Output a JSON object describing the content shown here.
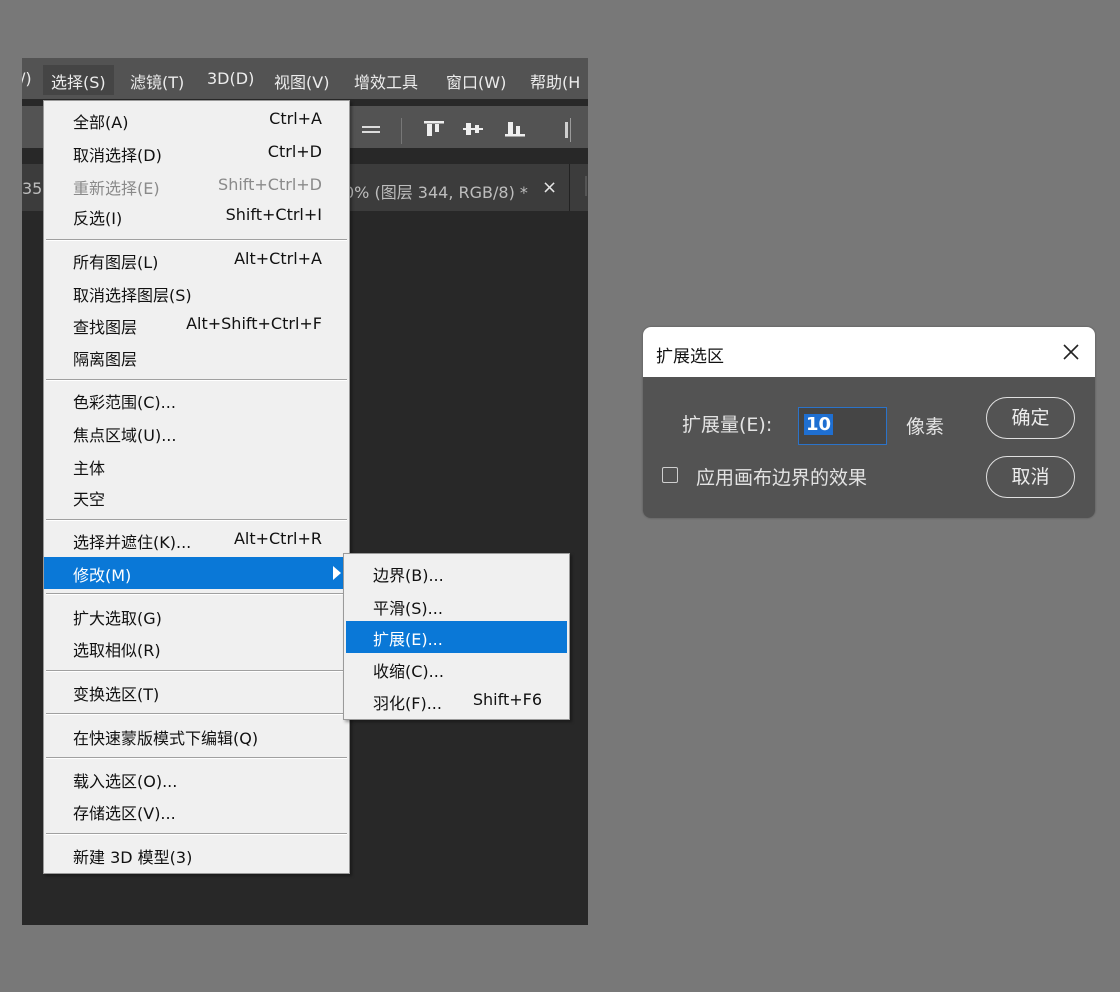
{
  "menubar": {
    "partial_left": "/)",
    "select": "选择(S)",
    "filter": "滤镜(T)",
    "three_d": "3D(D)",
    "view": "视图(V)",
    "plugins": "增效工具",
    "window": "窗口(W)",
    "help": "帮助(H"
  },
  "document_tab": {
    "left_fragment": "35",
    "title": "0% (图层 344, RGB/8) *",
    "close": "×"
  },
  "select_menu": {
    "items": [
      {
        "label": "全部(A)",
        "shortcut": "Ctrl+A"
      },
      {
        "label": "取消选择(D)",
        "shortcut": "Ctrl+D"
      },
      {
        "label": "重新选择(E)",
        "shortcut": "Shift+Ctrl+D"
      },
      {
        "label": "反选(I)",
        "shortcut": "Shift+Ctrl+I"
      },
      {
        "label": "所有图层(L)",
        "shortcut": "Alt+Ctrl+A"
      },
      {
        "label": "取消选择图层(S)",
        "shortcut": ""
      },
      {
        "label": "查找图层",
        "shortcut": "Alt+Shift+Ctrl+F"
      },
      {
        "label": "隔离图层",
        "shortcut": ""
      },
      {
        "label": "色彩范围(C)...",
        "shortcut": ""
      },
      {
        "label": "焦点区域(U)...",
        "shortcut": ""
      },
      {
        "label": "主体",
        "shortcut": ""
      },
      {
        "label": "天空",
        "shortcut": ""
      },
      {
        "label": "选择并遮住(K)...",
        "shortcut": "Alt+Ctrl+R"
      },
      {
        "label": "修改(M)",
        "shortcut": ""
      },
      {
        "label": "扩大选取(G)",
        "shortcut": ""
      },
      {
        "label": "选取相似(R)",
        "shortcut": ""
      },
      {
        "label": "变换选区(T)",
        "shortcut": ""
      },
      {
        "label": "在快速蒙版模式下编辑(Q)",
        "shortcut": ""
      },
      {
        "label": "载入选区(O)...",
        "shortcut": ""
      },
      {
        "label": "存储选区(V)...",
        "shortcut": ""
      },
      {
        "label": "新建 3D 模型(3)",
        "shortcut": ""
      }
    ]
  },
  "modify_submenu": {
    "items": [
      {
        "label": "边界(B)...",
        "shortcut": ""
      },
      {
        "label": "平滑(S)...",
        "shortcut": ""
      },
      {
        "label": "扩展(E)...",
        "shortcut": ""
      },
      {
        "label": "收缩(C)...",
        "shortcut": ""
      },
      {
        "label": "羽化(F)...",
        "shortcut": "Shift+F6"
      }
    ]
  },
  "expand_dialog": {
    "title": "扩展选区",
    "close_glyph": "✕",
    "amount_label": "扩展量(E):",
    "amount_value": "10",
    "unit": "像素",
    "ok_label": "确定",
    "cancel_label": "取消",
    "apply_canvas_bounds_label": "应用画布边界的效果",
    "apply_canvas_bounds_checked": false
  },
  "colors": {
    "menu_highlight": "#0a78d7",
    "input_border": "#2b73c9",
    "dialog_bg": "#535353",
    "workspace_bg": "#282828",
    "desktop_bg": "#787878"
  }
}
